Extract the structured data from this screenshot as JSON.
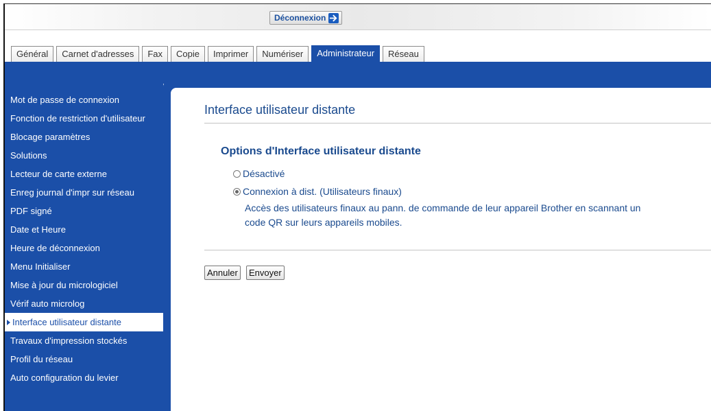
{
  "header": {
    "logout_label": "Déconnexion",
    "logout_icon": "arrow-right-icon"
  },
  "tabs": [
    {
      "label": "Général"
    },
    {
      "label": "Carnet d'adresses"
    },
    {
      "label": "Fax"
    },
    {
      "label": "Copie"
    },
    {
      "label": "Imprimer"
    },
    {
      "label": "Numériser"
    },
    {
      "label": "Administrateur",
      "active": true
    },
    {
      "label": "Réseau"
    }
  ],
  "sidebar": {
    "items": [
      {
        "label": "Mot de passe de connexion"
      },
      {
        "label": "Fonction de restriction d'utilisateur"
      },
      {
        "label": "Blocage paramètres"
      },
      {
        "label": "Solutions"
      },
      {
        "label": "Lecteur de carte externe"
      },
      {
        "label": "Enreg journal d'impr sur réseau"
      },
      {
        "label": "PDF signé"
      },
      {
        "label": "Date et Heure"
      },
      {
        "label": "Heure de déconnexion"
      },
      {
        "label": "Menu Initialiser"
      },
      {
        "label": "Mise à jour du micrologiciel"
      },
      {
        "label": "Vérif auto microlog"
      },
      {
        "label": "Interface utilisateur distante",
        "active": true
      },
      {
        "label": "Travaux d'impression stockés"
      },
      {
        "label": "Profil du réseau"
      },
      {
        "label": "Auto configuration du levier"
      }
    ]
  },
  "main": {
    "title": "Interface utilisateur distante",
    "section_title": "Options d'Interface utilisateur distante",
    "options": [
      {
        "label": "Désactivé",
        "checked": false
      },
      {
        "label": "Connexion à dist. (Utilisateurs finaux)",
        "checked": true
      }
    ],
    "description_line1": "Accès des utilisateurs finaux au pann. de commande de leur appareil Brother en scannant un",
    "description_line2": "code QR sur leurs appareils mobiles.",
    "cancel_label": "Annuler",
    "submit_label": "Envoyer"
  },
  "colors": {
    "brand_blue": "#1b4fa8",
    "title_blue": "#1a4a8e"
  }
}
